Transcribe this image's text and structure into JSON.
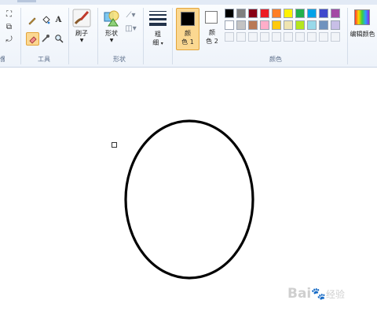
{
  "groups": {
    "tools_label": "工具",
    "shapes_label": "形状",
    "colors_label": "颜色"
  },
  "buttons": {
    "brush_label": "刷子",
    "shape_label": "形状",
    "size_label_1": "粗",
    "size_label_2": "细",
    "color1_label_1": "颜",
    "color1_label_2": "色 1",
    "color2_label_1": "颜",
    "color2_label_2": "色 2",
    "edit_colors_label": "编辑颜色",
    "text_tool_glyph": "A"
  },
  "colors": {
    "color1": "#000000",
    "color2": "#ffffff",
    "palette_row1": [
      "#000000",
      "#7f7f7f",
      "#880015",
      "#ed1c24",
      "#ff7f27",
      "#fff200",
      "#22b14c",
      "#00a2e8",
      "#3f48cc",
      "#a349a4"
    ],
    "palette_row2": [
      "#ffffff",
      "#c3c3c3",
      "#b97a57",
      "#ffaec9",
      "#ffc90e",
      "#efe4b0",
      "#b5e61d",
      "#99d9ea",
      "#7092be",
      "#c8bfe7"
    ]
  },
  "watermark": {
    "logo": "Bai",
    "logo2": "经验"
  }
}
